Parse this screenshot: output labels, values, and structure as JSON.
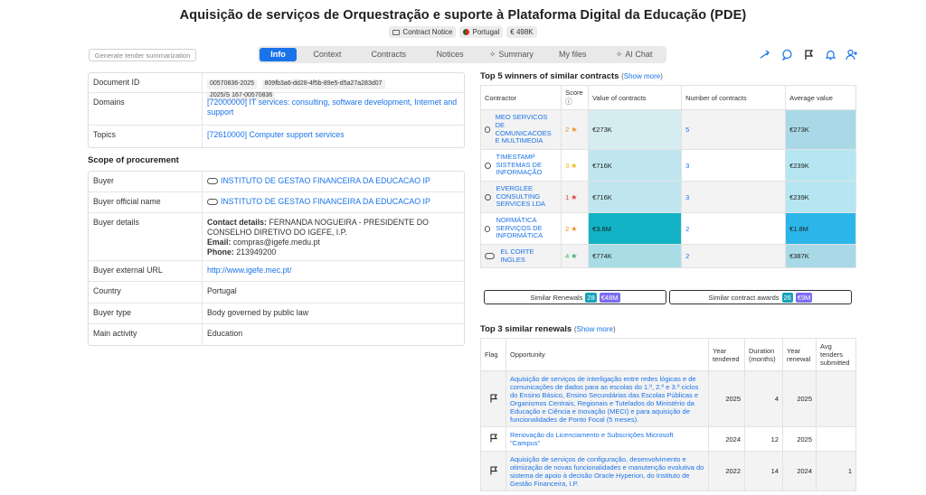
{
  "header": {
    "title": "Aquisição de serviços de Orquestração e suporte à Plataforma Digital da Educação (PDE)",
    "badges": {
      "type": "Contract Notice",
      "country": "Portugal",
      "value": "€ 498K"
    }
  },
  "toolbar": {
    "generate_label": "Generate tender summarization"
  },
  "tabs": [
    {
      "label": "Info"
    },
    {
      "label": "Context"
    },
    {
      "label": "Contracts"
    },
    {
      "label": "Notices"
    },
    {
      "label": "Summary"
    },
    {
      "label": "My files"
    },
    {
      "label": "AI Chat"
    }
  ],
  "details": {
    "document_id": {
      "label": "Document ID",
      "chips": [
        "00570836-2025",
        "809fb3a6-dd28-4f5b-89e5-d5a27a283d07",
        "2025/S 167-00570836"
      ]
    },
    "domains": {
      "label": "Domains",
      "value": "[72000000] IT services: consulting, software development, Internet and support"
    },
    "topics": {
      "label": "Topics",
      "value": "[72610000] Computer support services"
    }
  },
  "scope": {
    "title": "Scope of procurement",
    "buyer": {
      "label": "Buyer",
      "value": "INSTITUTO DE GESTAO FINANCEIRA DA EDUCACAO IP"
    },
    "buyer_official": {
      "label": "Buyer official name",
      "value": "INSTITUTO DE GESTAO FINANCEIRA DA EDUCACAO IP"
    },
    "buyer_details": {
      "label": "Buyer details",
      "contact_label": "Contact details:",
      "contact_value": "FERNANDA NOGUEIRA - PRESIDENTE DO CONSELHO DIRETIVO DO IGEFE, I.P.",
      "email_label": "Email:",
      "email_value": "compras@igefe.medu.pt",
      "phone_label": "Phone:",
      "phone_value": "213949200"
    },
    "external_url": {
      "label": "Buyer external URL",
      "value": "http://www.igefe.mec.pt/"
    },
    "country": {
      "label": "Country",
      "value": "Portugal"
    },
    "buyer_type": {
      "label": "Buyer type",
      "value": "Body governed by public law"
    },
    "main_activity": {
      "label": "Main activity",
      "value": "Education"
    }
  },
  "winners": {
    "title": "Top 5 winners of similar contracts",
    "show_more": "Show more",
    "headers": {
      "contractor": "Contractor",
      "score": "Score",
      "value": "Value of contracts",
      "number": "Number of contracts",
      "average": "Average value"
    },
    "rows": [
      {
        "name": "MEO SERVICOS DE COMUNICACOES E MULTIMEDIA",
        "score": "2",
        "value": "€273K",
        "number": "5",
        "average": "€273K",
        "value_bg": "#d5ecf0",
        "avg_bg": "#a9d9e6",
        "star": "#f08a24"
      },
      {
        "name": "TIMESTAMP SISTEMAS DE INFORMAÇÃO",
        "score": "3",
        "value": "€716K",
        "number": "3",
        "average": "€239K",
        "value_bg": "#bfe6ee",
        "avg_bg": "#b7e6f3",
        "star": "#f5b400"
      },
      {
        "name": "EVERGLEE CONSULTING SERVICES LDA",
        "score": "1",
        "value": "€716K",
        "number": "3",
        "average": "€239K",
        "value_bg": "#bfe6ee",
        "avg_bg": "#b7e6f3",
        "star": "#e53935"
      },
      {
        "name": "NORMÁTICA SERVIÇOS DE INFORMÁTICA",
        "score": "2",
        "value": "€3.6M",
        "number": "2",
        "average": "€1.8M",
        "value_bg": "#11b3c4",
        "avg_bg": "#2bb6ea",
        "star": "#f08a24"
      },
      {
        "name": "EL CORTE INGLES",
        "score": "4",
        "value": "€774K",
        "number": "2",
        "average": "€387K",
        "value_bg": "#a8dde5",
        "avg_bg": "#a9d9e6",
        "star": "#33b56b"
      }
    ]
  },
  "similar": {
    "renewals_label": "Similar Renewals",
    "renewals_count": "28",
    "renewals_value": "€48M",
    "awards_label": "Similar contract awards",
    "awards_count": "26",
    "awards_value": "€9M"
  },
  "renewals": {
    "title": "Top 3 similar renewals",
    "show_more": "Show more",
    "headers": {
      "flag": "Flag",
      "opportunity": "Opportunity",
      "year_tendered": "Year tendered",
      "duration": "Duration (months)",
      "year_renewal": "Year renewal",
      "avg_tenders": "Avg tenders submitted"
    },
    "rows": [
      {
        "opportunity": "Aquisição de serviços de interligação entre redes lógicas e de comunicações de dados para as escolas do 1.º, 2.º e 3.º ciclos do Ensino Básico, Ensino Secundárias das Escolas Públicas e Organismos Centrais, Regionais e Tutelados do Ministério da Educação e Ciência e Inovação (MECI) e para aquisição de funcionalidades de Ponto Focal (5 meses).",
        "year_tendered": "2025",
        "duration": "4",
        "year_renewal": "2025",
        "avg": ""
      },
      {
        "opportunity": "Renovação do Licenciamento e Subscrições Microsoft \"Campus\"",
        "year_tendered": "2024",
        "duration": "12",
        "year_renewal": "2025",
        "avg": ""
      },
      {
        "opportunity": "Aquisição de serviços de configuração, desenvolvimento e otimização de novas funcionalidades e manutenção evolutiva do sistema de apoio à decisão Oracle Hyperion, do Instituto de Gestão Financeira, I.P.",
        "year_tendered": "2022",
        "duration": "14",
        "year_renewal": "2024",
        "avg": "1"
      }
    ]
  }
}
